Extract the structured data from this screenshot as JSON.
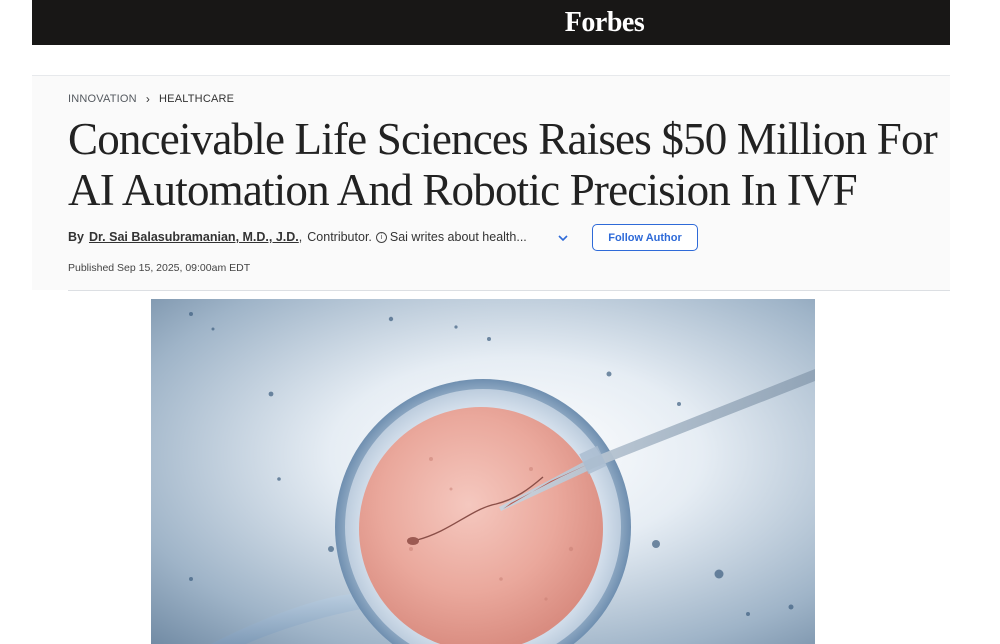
{
  "header": {
    "logo": "Forbes"
  },
  "breadcrumb": {
    "section": "INNOVATION",
    "subsection": "HEALTHCARE"
  },
  "article": {
    "headline": "Conceivable Life Sciences Raises $50 Million For AI Automation And Robotic Precision In IVF",
    "byline_prefix": "By",
    "author": "Dr. Sai Balasubramanian, M.D., J.D.",
    "author_suffix": ",",
    "role": "Contributor.",
    "bio_snippet": "Sai writes about health...",
    "follow_label": "Follow Author",
    "published": "Published Sep 15, 2025, 09:00am EDT"
  },
  "colors": {
    "topbar": "#181716",
    "accent": "#2e6ad8",
    "headline": "#222222"
  },
  "icons": {
    "info": "info-icon",
    "chevron": "chevron-down-icon",
    "breadcrumb_sep": "chevron-right-icon"
  }
}
